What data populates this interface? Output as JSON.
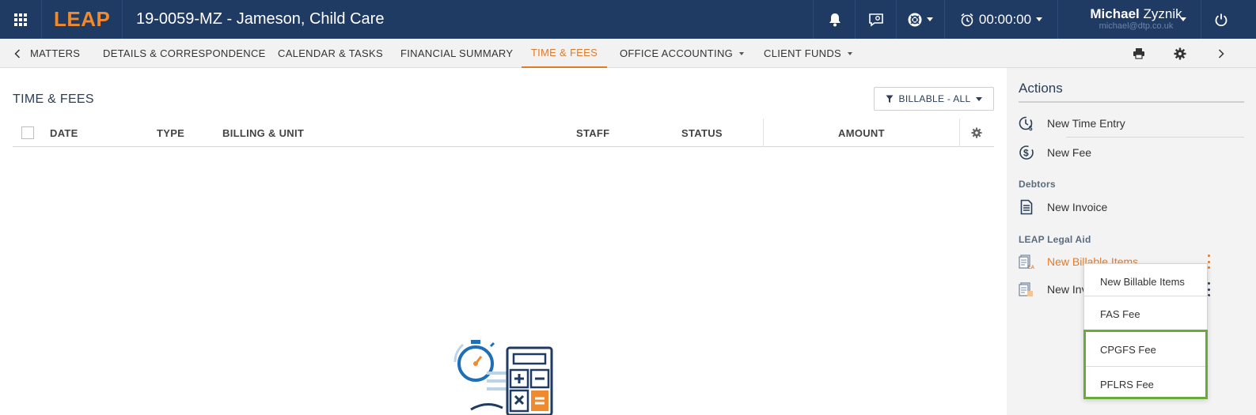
{
  "app": {
    "logo": "LEAP",
    "matter_title": "19-0059-MZ - Jameson, Child Care",
    "timer": "00:00:00",
    "user": {
      "first_name": "Michael",
      "last_name": "Zyznik",
      "email": "michael@dtp.co.uk"
    }
  },
  "nav": {
    "tabs": [
      {
        "label": "MATTERS"
      },
      {
        "label": "DETAILS & CORRESPONDENCE"
      },
      {
        "label": "CALENDAR & TASKS"
      },
      {
        "label": "FINANCIAL SUMMARY"
      },
      {
        "label": "TIME & FEES",
        "active": true
      },
      {
        "label": "OFFICE ACCOUNTING"
      },
      {
        "label": "CLIENT FUNDS"
      }
    ]
  },
  "main": {
    "title": "TIME & FEES",
    "filter_label": "BILLABLE - ALL",
    "columns": [
      "DATE",
      "TYPE",
      "BILLING & UNIT",
      "STAFF",
      "STATUS",
      "AMOUNT"
    ]
  },
  "actions": {
    "title": "Actions",
    "items": [
      {
        "label": "New Time Entry",
        "icon": "clock-dollar-icon"
      },
      {
        "label": "New Fee",
        "icon": "dollar-circle-icon"
      }
    ],
    "debtors": {
      "label": "Debtors",
      "items": [
        {
          "label": "New Invoice",
          "icon": "invoice-icon"
        }
      ]
    },
    "legal_aid": {
      "label": "LEAP Legal Aid",
      "items": [
        {
          "label": "New Billable Items",
          "icon": "billable-items-icon"
        },
        {
          "label": "New Inv",
          "icon": "legal-aid-invoice-icon"
        }
      ]
    }
  },
  "dropdown": {
    "items": [
      "New Billable Items",
      "FAS Fee",
      "CPGFS Fee",
      "PFLRS Fee"
    ]
  },
  "colors": {
    "topbar": "#1f3a63",
    "accent": "#e07b2c",
    "highlight": "#6aaa3c"
  }
}
